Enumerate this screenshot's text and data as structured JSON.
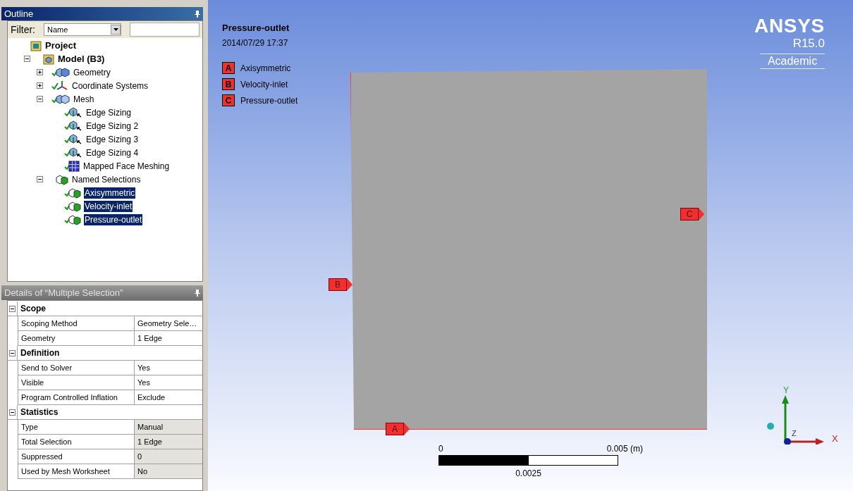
{
  "outline": {
    "title": "Outline",
    "filter": {
      "label": "Filter:",
      "value": "Name"
    },
    "tree": [
      {
        "label": "Project",
        "kind": "project",
        "checked": false,
        "selected": false,
        "bold": true,
        "children": [
          {
            "label": "Model (B3)",
            "kind": "model",
            "checked": false,
            "selected": false,
            "bold": true,
            "expanded": true,
            "children": [
              {
                "label": "Geometry",
                "kind": "geometry",
                "checked": true,
                "selected": false,
                "bold": false,
                "expanded": false
              },
              {
                "label": "Coordinate Systems",
                "kind": "coords",
                "checked": true,
                "selected": false,
                "bold": false,
                "expanded": false
              },
              {
                "label": "Mesh",
                "kind": "mesh",
                "checked": true,
                "selected": false,
                "bold": false,
                "expanded": true,
                "children": [
                  {
                    "label": "Edge Sizing",
                    "kind": "sizing",
                    "checked": true,
                    "selected": false,
                    "bold": false
                  },
                  {
                    "label": "Edge Sizing 2",
                    "kind": "sizing",
                    "checked": true,
                    "selected": false,
                    "bold": false
                  },
                  {
                    "label": "Edge Sizing 3",
                    "kind": "sizing",
                    "checked": true,
                    "selected": false,
                    "bold": false
                  },
                  {
                    "label": "Edge Sizing 4",
                    "kind": "sizing",
                    "checked": true,
                    "selected": false,
                    "bold": false
                  },
                  {
                    "label": "Mapped Face Meshing",
                    "kind": "mapped",
                    "checked": true,
                    "selected": false,
                    "bold": false
                  }
                ]
              },
              {
                "label": "Named Selections",
                "kind": "named",
                "checked": false,
                "selected": false,
                "bold": false,
                "expanded": true,
                "children": [
                  {
                    "label": "Axisymmetric",
                    "kind": "named",
                    "checked": true,
                    "selected": true,
                    "bold": false
                  },
                  {
                    "label": "Velocity-inlet",
                    "kind": "named",
                    "checked": true,
                    "selected": true,
                    "bold": false
                  },
                  {
                    "label": "Pressure-outlet",
                    "kind": "named",
                    "checked": true,
                    "selected": true,
                    "bold": false
                  }
                ]
              }
            ]
          }
        ]
      }
    ]
  },
  "details": {
    "title": "Details of “Multiple Selection”",
    "groups": [
      {
        "title": "Scope",
        "expanded": true,
        "rows": [
          {
            "label": "Scoping Method",
            "value": "Geometry Sele…",
            "read_only": false
          },
          {
            "label": "Geometry",
            "value": "1 Edge",
            "read_only": false
          }
        ]
      },
      {
        "title": "Definition",
        "expanded": true,
        "rows": [
          {
            "label": "Send to Solver",
            "value": "Yes",
            "read_only": false
          },
          {
            "label": "Visible",
            "value": "Yes",
            "read_only": false
          },
          {
            "label": "Program Controlled Inflation",
            "value": "Exclude",
            "read_only": false
          }
        ]
      },
      {
        "title": "Statistics",
        "expanded": true,
        "rows": [
          {
            "label": "Type",
            "value": "Manual",
            "read_only": true
          },
          {
            "label": "Total Selection",
            "value": "1 Edge",
            "read_only": true
          },
          {
            "label": "Suppressed",
            "value": "0",
            "read_only": true
          },
          {
            "label": "Used by Mesh Worksheet",
            "value": "No",
            "read_only": true
          }
        ]
      }
    ]
  },
  "viewport": {
    "title": "Pressure-outlet",
    "timestamp": "2014/07/29 17:37",
    "legend": [
      {
        "letter": "A",
        "label": "Axisymmetric"
      },
      {
        "letter": "B",
        "label": "Velocity-inlet"
      },
      {
        "letter": "C",
        "label": "Pressure-outlet"
      }
    ],
    "flags": [
      {
        "letter": "C",
        "kind": "right"
      },
      {
        "letter": "B",
        "kind": "left"
      },
      {
        "letter": "A",
        "kind": "bottom"
      }
    ],
    "logo": {
      "brand": "ANSYS",
      "version": "R15.0",
      "edition": "Academic"
    },
    "scale": {
      "start": "0",
      "end": "0.005 (m)",
      "mid": "0.0025"
    },
    "triad": {
      "y": "Y",
      "z": "Z",
      "x": "X"
    }
  }
}
